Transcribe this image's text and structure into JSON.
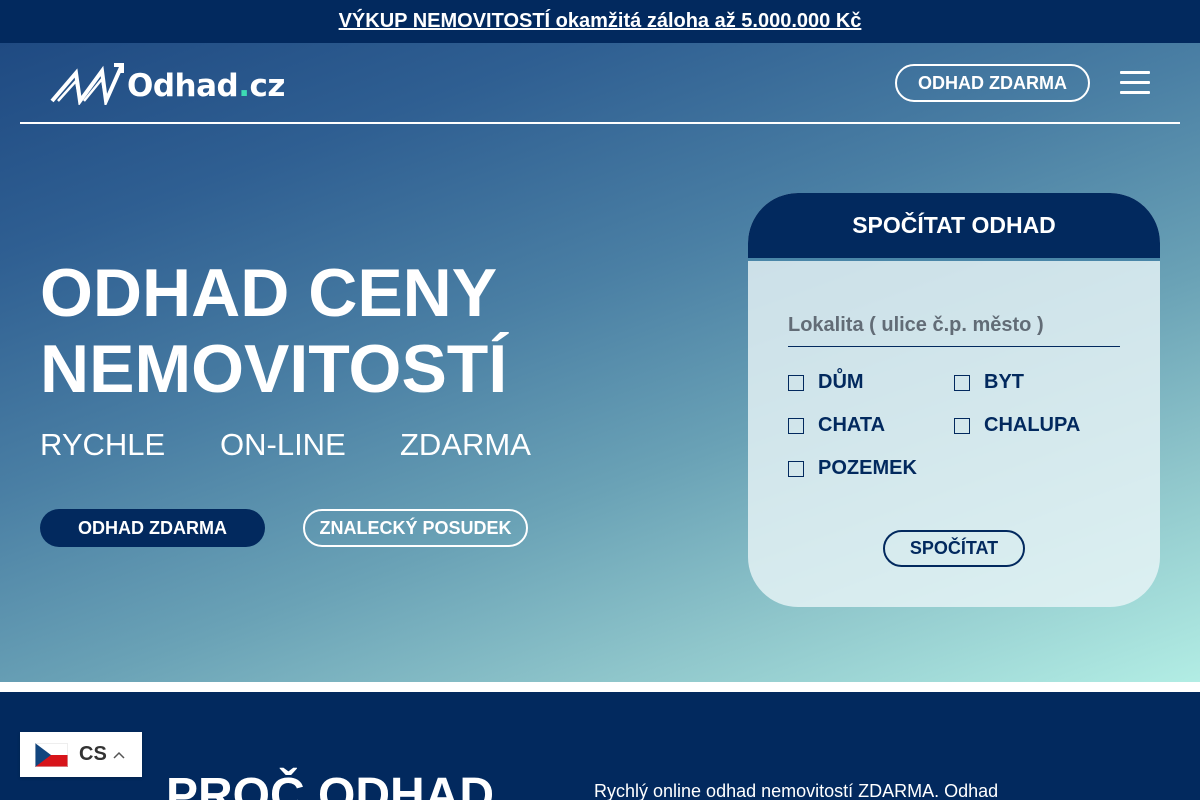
{
  "promo_banner": {
    "text": "VÝKUP NEMOVITOSTÍ okamžitá záloha až 5.000.000 Kč"
  },
  "header": {
    "logo_text_main": "Odhad",
    "logo_text_dot": ".",
    "logo_text_tld": "cz",
    "cta_label": "ODHAD ZDARMA",
    "menu_icon": "hamburger-icon"
  },
  "hero": {
    "title_line1": "ODHAD CENY",
    "title_line2": "NEMOVITOSTÍ",
    "tagline": [
      "RYCHLE",
      "ON-LINE",
      "ZDARMA"
    ],
    "primary_button": "ODHAD ZDARMA",
    "secondary_button": "ZNALECKÝ POSUDEK"
  },
  "calculator": {
    "title": "SPOČÍTAT ODHAD",
    "location_placeholder": "Lokalita ( ulice č.p. město )",
    "property_types": [
      {
        "label": "DŮM",
        "checked": false
      },
      {
        "label": "BYT",
        "checked": false
      },
      {
        "label": "CHATA",
        "checked": false
      },
      {
        "label": "CHALUPA",
        "checked": false
      },
      {
        "label": "POZEMEK",
        "checked": false
      }
    ],
    "submit_label": "SPOČÍTAT"
  },
  "next_section": {
    "title": "PROČ ODHAD",
    "text": "Rychlý online odhad nemovitostí ZDARMA. Odhad"
  },
  "language_switcher": {
    "code": "CS",
    "flag": "czech-flag-icon",
    "chevron": "chevron-up-icon"
  },
  "colors": {
    "navy": "#02295e",
    "accent_teal": "#3ddbb3",
    "white": "#ffffff"
  }
}
